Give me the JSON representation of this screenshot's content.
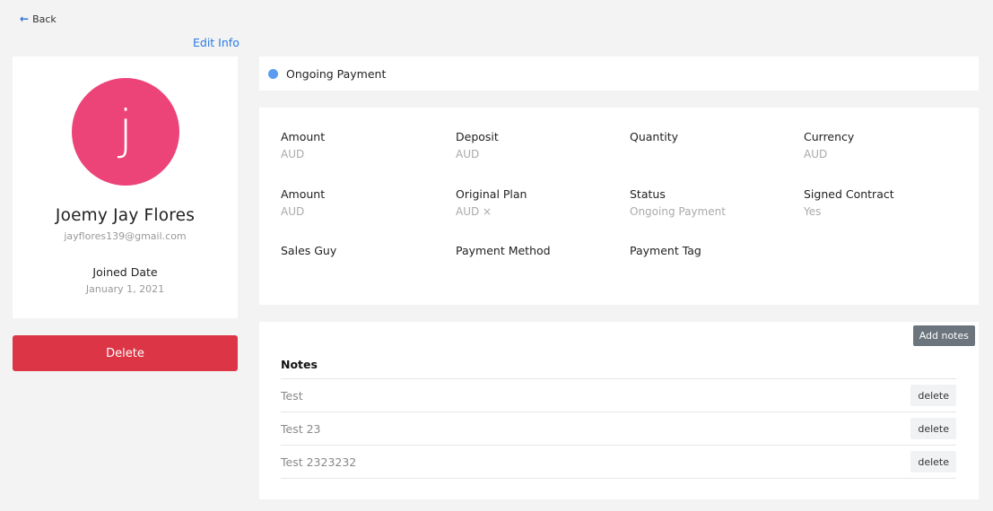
{
  "nav": {
    "back_label": "Back",
    "back_icon": "arrow-left-icon",
    "edit_label": "Edit Info"
  },
  "profile": {
    "avatar_letter": "j",
    "avatar_color": "#ec4379",
    "name": "Joemy Jay Flores",
    "email": "jayflores139@gmail.com",
    "joined_label": "Joined Date",
    "joined_value": "January 1, 2021",
    "delete_label": "Delete"
  },
  "status": {
    "text": "Ongoing Payment",
    "dot_color": "#5b9cf0"
  },
  "details": [
    {
      "label": "Amount",
      "value": "AUD"
    },
    {
      "label": "Deposit",
      "value": "AUD"
    },
    {
      "label": "Quantity",
      "value": ""
    },
    {
      "label": "Currency",
      "value": "AUD"
    },
    {
      "label": "Amount",
      "value": "AUD"
    },
    {
      "label": "Original Plan",
      "value": "AUD ×"
    },
    {
      "label": "Status",
      "value": "Ongoing Payment"
    },
    {
      "label": "Signed Contract",
      "value": "Yes"
    },
    {
      "label": "Sales Guy",
      "value": ""
    },
    {
      "label": "Payment Method",
      "value": ""
    },
    {
      "label": "Payment Tag",
      "value": ""
    }
  ],
  "notes": {
    "title": "Notes",
    "add_label": "Add notes",
    "items": [
      {
        "text": "Test",
        "delete_label": "delete"
      },
      {
        "text": "Test 23",
        "delete_label": "delete"
      },
      {
        "text": "Test 2323232",
        "delete_label": "delete"
      }
    ]
  },
  "colors": {
    "accent": "#2a7be4",
    "danger": "#dc3545",
    "secondary": "#6c757d"
  }
}
